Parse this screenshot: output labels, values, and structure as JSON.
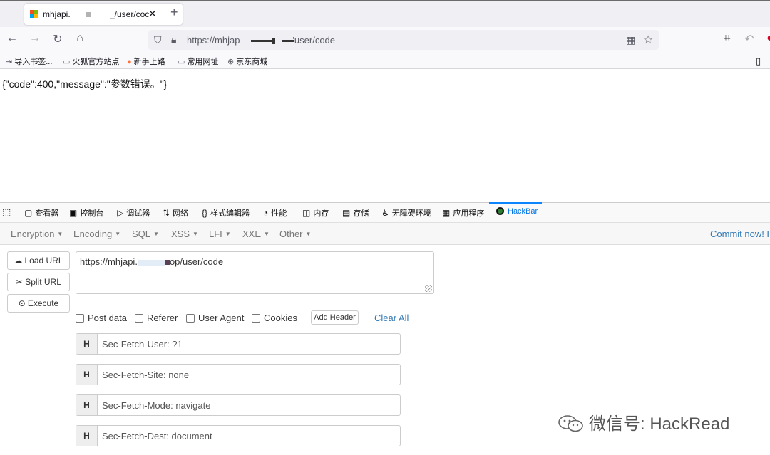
{
  "browser": {
    "tab": {
      "title": "mhjapi.",
      "path": "_/user/coc",
      "close": "✕"
    },
    "new_tab": "+",
    "url_prefix": "https://mhjap",
    "url_suffix": "'user/code"
  },
  "bookmarks": [
    {
      "icon": "import-icon",
      "label": "导入书签..."
    },
    {
      "icon": "folder-icon",
      "label": "火狐官方站点"
    },
    {
      "icon": "firefox-icon",
      "label": "新手上路"
    },
    {
      "icon": "folder-icon",
      "label": "常用网址"
    },
    {
      "icon": "globe-icon",
      "label": "京东商城"
    }
  ],
  "page": {
    "json_text": "{\"code\":400,\"message\":\"参数错误。\"}"
  },
  "devtools": {
    "tabs": [
      {
        "icon": "inspector-icon",
        "label": "查看器"
      },
      {
        "icon": "console-icon",
        "label": "控制台"
      },
      {
        "icon": "debugger-icon",
        "label": "调试器"
      },
      {
        "icon": "network-icon",
        "label": "网络"
      },
      {
        "icon": "style-editor-icon",
        "label": "样式编辑器"
      },
      {
        "icon": "performance-icon",
        "label": "性能"
      },
      {
        "icon": "memory-icon",
        "label": "内存"
      },
      {
        "icon": "storage-icon",
        "label": "存储"
      },
      {
        "icon": "accessibility-icon",
        "label": "无障碍环境"
      },
      {
        "icon": "application-icon",
        "label": "应用程序"
      },
      {
        "icon": "hackbar-icon",
        "label": "HackBar"
      }
    ],
    "active_tab": "HackBar"
  },
  "hackbar": {
    "menu": [
      "Encryption",
      "Encoding",
      "SQL",
      "XSS",
      "LFI",
      "XXE",
      "Other"
    ],
    "commit": "Commit now! H",
    "buttons": {
      "load": "Load URL",
      "split": "Split URL",
      "execute": "Execute"
    },
    "url_prefix": "https://mhjapi.",
    "url_suffix": "op/user/code",
    "options": {
      "post_data": "Post data",
      "referer": "Referer",
      "user_agent": "User Agent",
      "cookies": "Cookies"
    },
    "add_header": "Add Header",
    "clear_all": "Clear All",
    "header_tag": "H",
    "headers": [
      "Sec-Fetch-User: ?1",
      "Sec-Fetch-Site: none",
      "Sec-Fetch-Mode: navigate",
      "Sec-Fetch-Dest: document"
    ]
  },
  "watermark": "微信号: HackRead"
}
